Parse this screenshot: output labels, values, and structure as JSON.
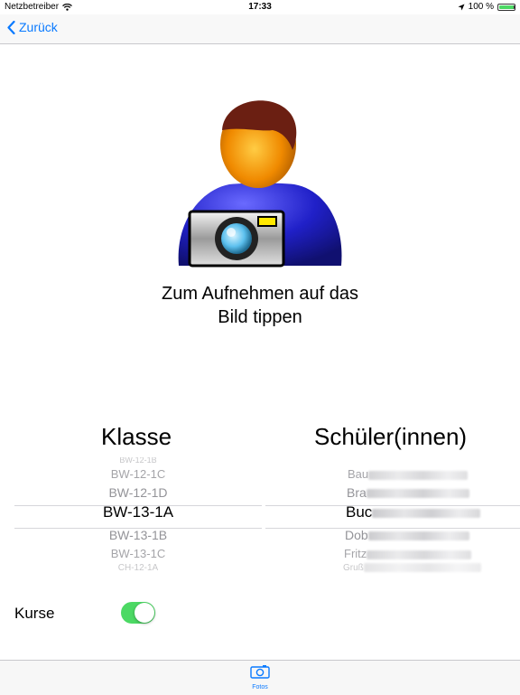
{
  "status_bar": {
    "carrier": "Netzbetreiber",
    "time": "17:33",
    "battery_percent": "100 %",
    "battery_level": 1.0
  },
  "nav": {
    "back_label": "Zurück"
  },
  "photo": {
    "instruction": "Zum Aufnehmen auf das Bild tippen"
  },
  "class_picker": {
    "title": "Klasse",
    "options": [
      "BW-12-1B",
      "BW-12-1C",
      "BW-12-1D",
      "BW-13-1A",
      "BW-13-1B",
      "BW-13-1C",
      "CH-12-1A"
    ],
    "selected": "BW-13-1A"
  },
  "student_picker": {
    "title": "Schüler(innen)",
    "options": [
      "Bau",
      "Bra",
      "Buc",
      "Dob",
      "Fritz",
      "Gruß"
    ],
    "selected": "Buc"
  },
  "courses_toggle": {
    "label": "Kurse",
    "on": true
  },
  "tab_bar": {
    "items": [
      {
        "label": "Fotos",
        "icon": "camera-icon"
      }
    ]
  },
  "colors": {
    "accent": "#0a7aff",
    "toggle_on": "#4cd964"
  }
}
